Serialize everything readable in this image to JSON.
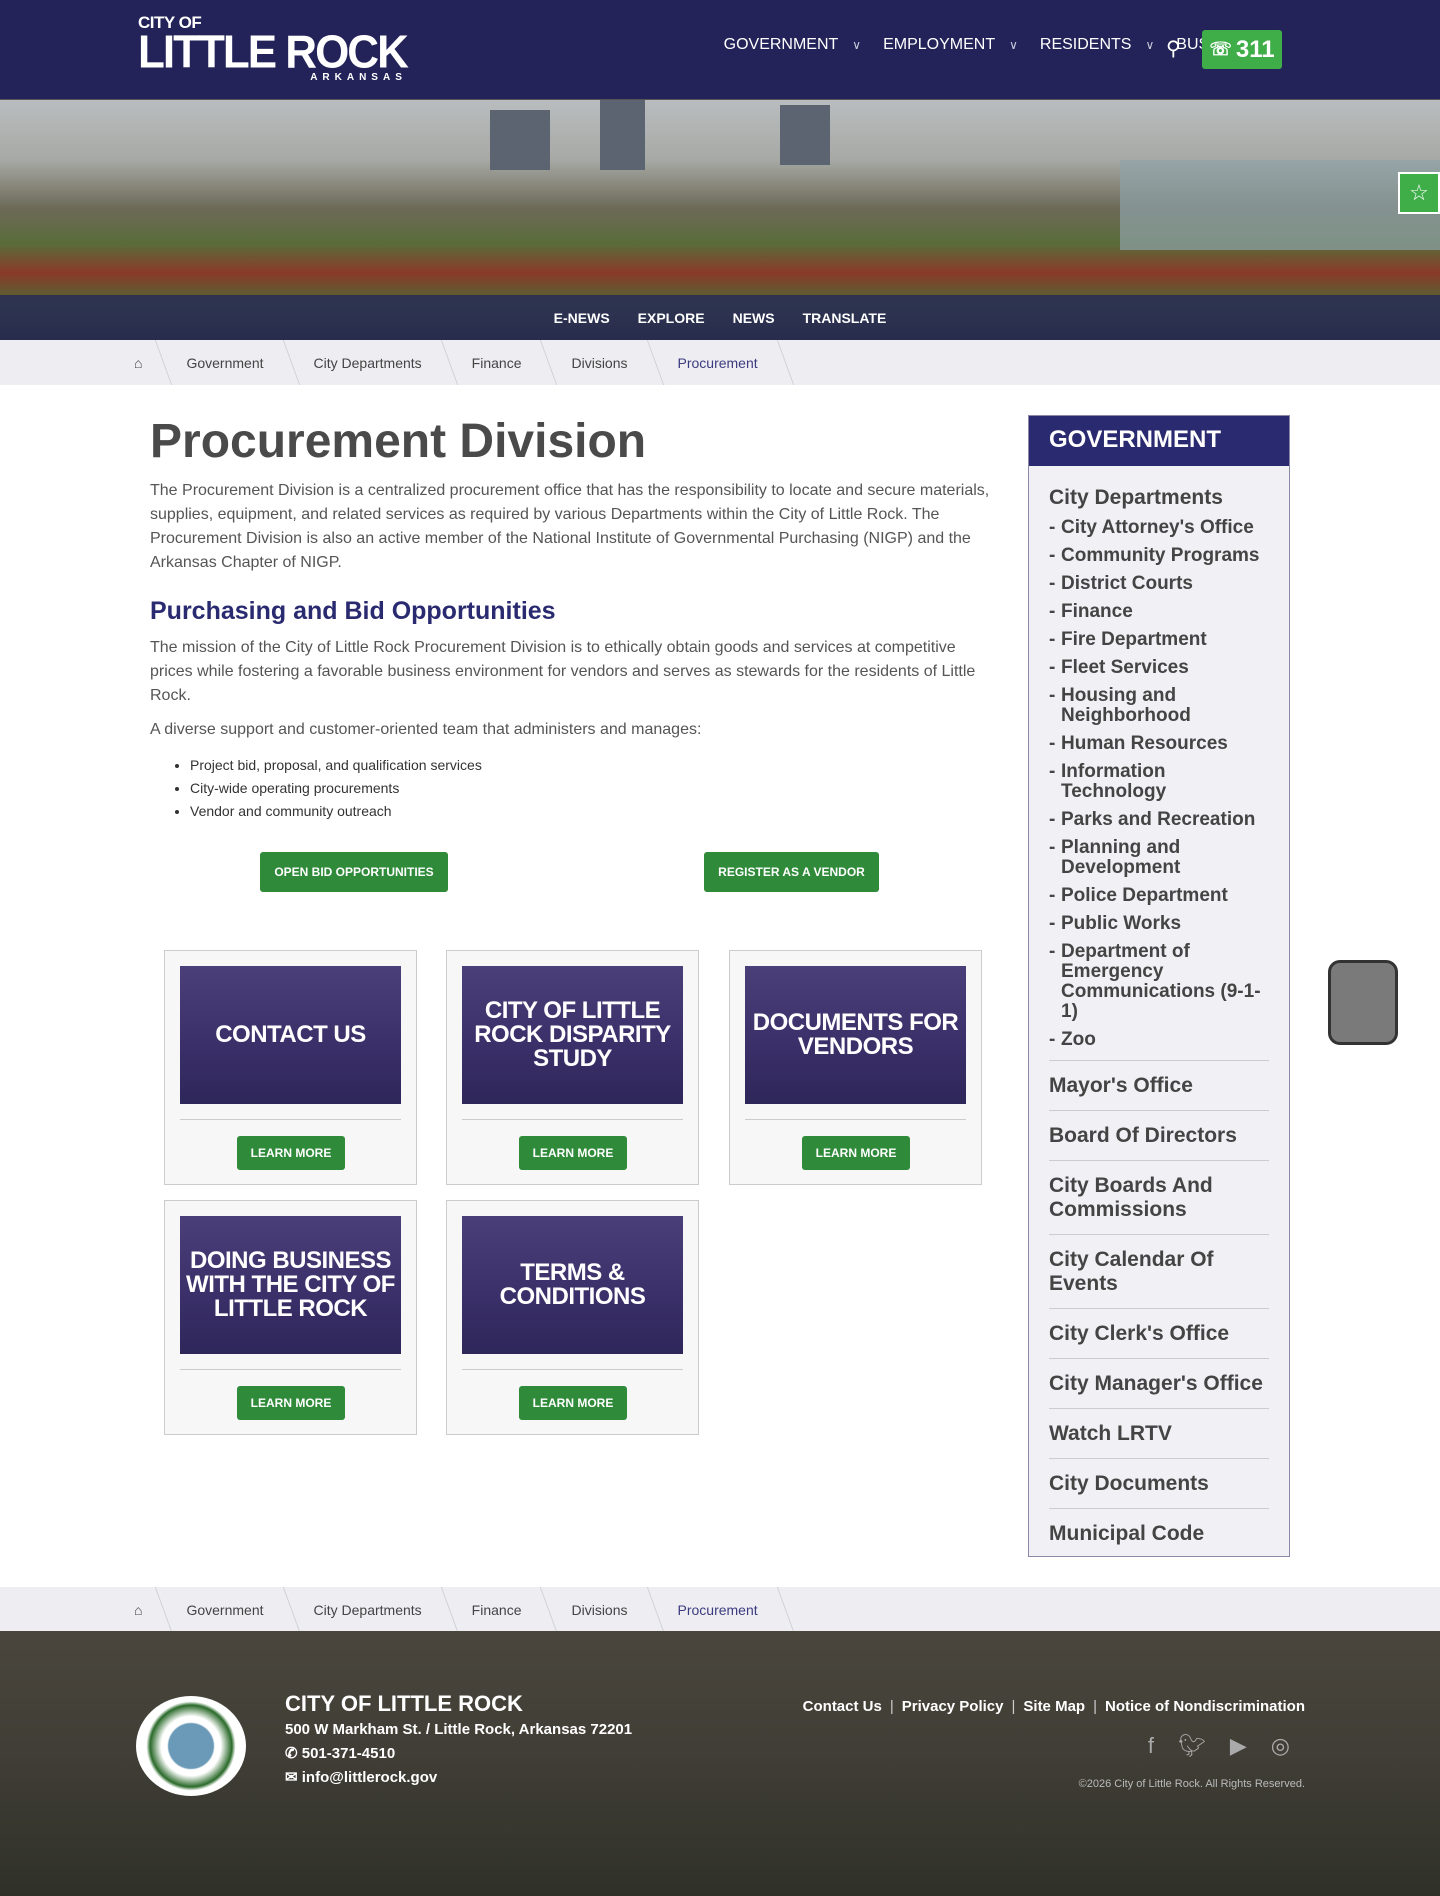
{
  "header": {
    "logo_top": "CITY OF",
    "logo_main": "LITTLE ROCK",
    "logo_sub": "ARKANSAS",
    "nav": [
      "GOVERNMENT",
      "EMPLOYMENT",
      "RESIDENTS",
      "BUSINESS"
    ],
    "btn311": "311"
  },
  "subnav": [
    "E-NEWS",
    "EXPLORE",
    "NEWS",
    "TRANSLATE"
  ],
  "breadcrumb": [
    "Government",
    "City Departments",
    "Finance",
    "Divisions",
    "Procurement"
  ],
  "main": {
    "title": "Procurement Division",
    "intro": "The Procurement Division is a centralized procurement office that has the responsibility to locate and secure materials, supplies, equipment, and related services as required by various Departments within the City of Little Rock. The Procurement Division is also an active member of the National Institute of Governmental Purchasing (NIGP) and the Arkansas Chapter of NIGP.",
    "h2": "Purchasing and Bid Opportunities",
    "mission": "The mission of the City of Little Rock Procurement Division is to ethically obtain goods and services at competitive prices while fostering a favorable business environment for vendors and serves as stewards for the residents of Little Rock.",
    "team": "A diverse support and customer-oriented team that administers and manages:",
    "bullets": [
      "Project bid, proposal, and qualification services",
      "City-wide operating procurements",
      "Vendor and community outreach"
    ],
    "btn_bids": "OPEN BID OPPORTUNITIES",
    "btn_vendor": "REGISTER AS A VENDOR"
  },
  "cards": [
    {
      "title": "CONTACT US",
      "btn": "LEARN MORE"
    },
    {
      "title": "CITY OF LITTLE ROCK DISPARITY STUDY",
      "btn": "LEARN MORE"
    },
    {
      "title": "DOCUMENTS FOR VENDORS",
      "btn": "LEARN MORE"
    },
    {
      "title": "DOING BUSINESS WITH THE CITY OF LITTLE ROCK",
      "btn": "LEARN MORE"
    },
    {
      "title": "TERMS & CONDITIONS",
      "btn": "LEARN MORE"
    }
  ],
  "sidebar": {
    "heading": "GOVERNMENT",
    "top": "City Departments",
    "sub": [
      "City Attorney's Office",
      "Community Programs",
      "District Courts",
      "Finance",
      "Fire Department",
      "Fleet Services",
      "Housing and Neighborhood",
      "Human Resources",
      "Information Technology",
      "Parks and Recreation",
      "Planning and Development",
      "Police Department",
      "Public Works",
      "Department of Emergency Communications (9-1-1)",
      "Zoo"
    ],
    "sections": [
      "Mayor's Office",
      "Board Of Directors",
      "City Boards And Commissions",
      "City Calendar Of Events",
      "City Clerk's Office",
      "City Manager's Office",
      "Watch LRTV",
      "City Documents",
      "Municipal Code"
    ]
  },
  "footer": {
    "title": "CITY OF LITTLE ROCK",
    "address": "500 W Markham St. / Little Rock, Arkansas 72201",
    "phone": "501-371-4510",
    "email": "info@littlerock.gov",
    "links": [
      "Contact Us",
      "Privacy Policy",
      "Site Map",
      "Notice of Nondiscrimination"
    ],
    "copyright": "©2026 City of Little Rock. All Rights Reserved."
  }
}
